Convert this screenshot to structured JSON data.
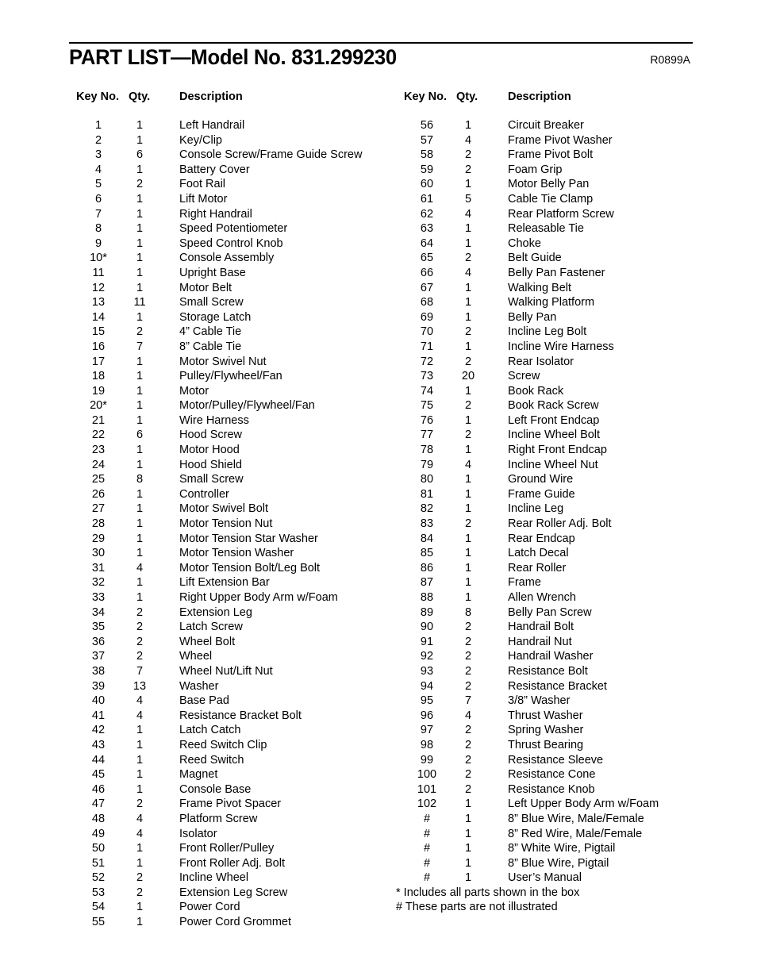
{
  "title": "PART LIST—Model No. 831.299230",
  "code": "R0899A",
  "headers": {
    "key": "Key No.",
    "qty": "Qty.",
    "desc": "Description"
  },
  "left_parts": [
    {
      "key": "1",
      "qty": "1",
      "desc": "Left Handrail"
    },
    {
      "key": "2",
      "qty": "1",
      "desc": "Key/Clip"
    },
    {
      "key": "3",
      "qty": "6",
      "desc": "Console Screw/Frame Guide Screw"
    },
    {
      "key": "4",
      "qty": "1",
      "desc": "Battery Cover"
    },
    {
      "key": "5",
      "qty": "2",
      "desc": "Foot Rail"
    },
    {
      "key": "6",
      "qty": "1",
      "desc": "Lift Motor"
    },
    {
      "key": "7",
      "qty": "1",
      "desc": "Right Handrail"
    },
    {
      "key": "8",
      "qty": "1",
      "desc": "Speed Potentiometer"
    },
    {
      "key": "9",
      "qty": "1",
      "desc": "Speed Control Knob"
    },
    {
      "key": "10*",
      "qty": "1",
      "desc": "Console Assembly"
    },
    {
      "key": "11",
      "qty": "1",
      "desc": "Upright Base"
    },
    {
      "key": "12",
      "qty": "1",
      "desc": "Motor Belt"
    },
    {
      "key": "13",
      "qty": "11",
      "desc": "Small Screw"
    },
    {
      "key": "14",
      "qty": "1",
      "desc": "Storage Latch"
    },
    {
      "key": "15",
      "qty": "2",
      "desc": "4” Cable Tie"
    },
    {
      "key": "16",
      "qty": "7",
      "desc": "8” Cable Tie"
    },
    {
      "key": "17",
      "qty": "1",
      "desc": "Motor Swivel Nut"
    },
    {
      "key": "18",
      "qty": "1",
      "desc": "Pulley/Flywheel/Fan"
    },
    {
      "key": "19",
      "qty": "1",
      "desc": "Motor"
    },
    {
      "key": "20*",
      "qty": "1",
      "desc": "Motor/Pulley/Flywheel/Fan"
    },
    {
      "key": "21",
      "qty": "1",
      "desc": "Wire Harness"
    },
    {
      "key": "22",
      "qty": "6",
      "desc": "Hood Screw"
    },
    {
      "key": "23",
      "qty": "1",
      "desc": "Motor Hood"
    },
    {
      "key": "24",
      "qty": "1",
      "desc": "Hood Shield"
    },
    {
      "key": "25",
      "qty": "8",
      "desc": "Small Screw"
    },
    {
      "key": "26",
      "qty": "1",
      "desc": "Controller"
    },
    {
      "key": "27",
      "qty": "1",
      "desc": "Motor Swivel Bolt"
    },
    {
      "key": "28",
      "qty": "1",
      "desc": "Motor Tension Nut"
    },
    {
      "key": "29",
      "qty": "1",
      "desc": "Motor Tension Star Washer"
    },
    {
      "key": "30",
      "qty": "1",
      "desc": "Motor Tension Washer"
    },
    {
      "key": "31",
      "qty": "4",
      "desc": "Motor Tension Bolt/Leg Bolt"
    },
    {
      "key": "32",
      "qty": "1",
      "desc": "Lift Extension Bar"
    },
    {
      "key": "33",
      "qty": "1",
      "desc": "Right Upper Body Arm w/Foam"
    },
    {
      "key": "34",
      "qty": "2",
      "desc": "Extension Leg"
    },
    {
      "key": "35",
      "qty": "2",
      "desc": "Latch Screw"
    },
    {
      "key": "36",
      "qty": "2",
      "desc": "Wheel Bolt"
    },
    {
      "key": "37",
      "qty": "2",
      "desc": "Wheel"
    },
    {
      "key": "38",
      "qty": "7",
      "desc": "Wheel Nut/Lift Nut"
    },
    {
      "key": "39",
      "qty": "13",
      "desc": "Washer"
    },
    {
      "key": "40",
      "qty": "4",
      "desc": "Base Pad"
    },
    {
      "key": "41",
      "qty": "4",
      "desc": "Resistance Bracket Bolt"
    },
    {
      "key": "42",
      "qty": "1",
      "desc": "Latch Catch"
    },
    {
      "key": "43",
      "qty": "1",
      "desc": "Reed Switch Clip"
    },
    {
      "key": "44",
      "qty": "1",
      "desc": "Reed Switch"
    },
    {
      "key": "45",
      "qty": "1",
      "desc": "Magnet"
    },
    {
      "key": "46",
      "qty": "1",
      "desc": "Console Base"
    },
    {
      "key": "47",
      "qty": "2",
      "desc": "Frame Pivot Spacer"
    },
    {
      "key": "48",
      "qty": "4",
      "desc": "Platform Screw"
    },
    {
      "key": "49",
      "qty": "4",
      "desc": "Isolator"
    },
    {
      "key": "50",
      "qty": "1",
      "desc": "Front Roller/Pulley"
    },
    {
      "key": "51",
      "qty": "1",
      "desc": "Front Roller Adj. Bolt"
    },
    {
      "key": "52",
      "qty": "2",
      "desc": "Incline Wheel"
    },
    {
      "key": "53",
      "qty": "2",
      "desc": "Extension Leg Screw"
    },
    {
      "key": "54",
      "qty": "1",
      "desc": "Power Cord"
    },
    {
      "key": "55",
      "qty": "1",
      "desc": "Power Cord Grommet"
    }
  ],
  "right_parts": [
    {
      "key": "56",
      "qty": "1",
      "desc": "Circuit Breaker"
    },
    {
      "key": "57",
      "qty": "4",
      "desc": "Frame Pivot Washer"
    },
    {
      "key": "58",
      "qty": "2",
      "desc": "Frame Pivot Bolt"
    },
    {
      "key": "59",
      "qty": "2",
      "desc": "Foam Grip"
    },
    {
      "key": "60",
      "qty": "1",
      "desc": "Motor Belly Pan"
    },
    {
      "key": "61",
      "qty": "5",
      "desc": "Cable Tie Clamp"
    },
    {
      "key": "62",
      "qty": "4",
      "desc": "Rear Platform Screw"
    },
    {
      "key": "63",
      "qty": "1",
      "desc": "Releasable Tie"
    },
    {
      "key": "64",
      "qty": "1",
      "desc": "Choke"
    },
    {
      "key": "65",
      "qty": "2",
      "desc": "Belt Guide"
    },
    {
      "key": "66",
      "qty": "4",
      "desc": "Belly Pan Fastener"
    },
    {
      "key": "67",
      "qty": "1",
      "desc": "Walking Belt"
    },
    {
      "key": "68",
      "qty": "1",
      "desc": "Walking Platform"
    },
    {
      "key": "69",
      "qty": "1",
      "desc": "Belly Pan"
    },
    {
      "key": "70",
      "qty": "2",
      "desc": "Incline Leg Bolt"
    },
    {
      "key": "71",
      "qty": "1",
      "desc": "Incline Wire Harness"
    },
    {
      "key": "72",
      "qty": "2",
      "desc": "Rear Isolator"
    },
    {
      "key": "73",
      "qty": "20",
      "desc": "Screw"
    },
    {
      "key": "74",
      "qty": "1",
      "desc": "Book Rack"
    },
    {
      "key": "75",
      "qty": "2",
      "desc": "Book Rack Screw"
    },
    {
      "key": "76",
      "qty": "1",
      "desc": "Left Front Endcap"
    },
    {
      "key": "77",
      "qty": "2",
      "desc": "Incline Wheel Bolt"
    },
    {
      "key": "78",
      "qty": "1",
      "desc": "Right Front Endcap"
    },
    {
      "key": "79",
      "qty": "4",
      "desc": "Incline Wheel Nut"
    },
    {
      "key": "80",
      "qty": "1",
      "desc": "Ground Wire"
    },
    {
      "key": "81",
      "qty": "1",
      "desc": "Frame Guide"
    },
    {
      "key": "82",
      "qty": "1",
      "desc": "Incline Leg"
    },
    {
      "key": "83",
      "qty": "2",
      "desc": "Rear Roller Adj. Bolt"
    },
    {
      "key": "84",
      "qty": "1",
      "desc": "Rear Endcap"
    },
    {
      "key": "85",
      "qty": "1",
      "desc": "Latch Decal"
    },
    {
      "key": "86",
      "qty": "1",
      "desc": "Rear Roller"
    },
    {
      "key": "87",
      "qty": "1",
      "desc": "Frame"
    },
    {
      "key": "88",
      "qty": "1",
      "desc": "Allen Wrench"
    },
    {
      "key": "89",
      "qty": "8",
      "desc": "Belly Pan Screw"
    },
    {
      "key": "90",
      "qty": "2",
      "desc": "Handrail Bolt"
    },
    {
      "key": "91",
      "qty": "2",
      "desc": "Handrail Nut"
    },
    {
      "key": "92",
      "qty": "2",
      "desc": "Handrail Washer"
    },
    {
      "key": "93",
      "qty": "2",
      "desc": "Resistance Bolt"
    },
    {
      "key": "94",
      "qty": "2",
      "desc": "Resistance Bracket"
    },
    {
      "key": "95",
      "qty": "7",
      "desc": "3/8” Washer"
    },
    {
      "key": "96",
      "qty": "4",
      "desc": "Thrust Washer"
    },
    {
      "key": "97",
      "qty": "2",
      "desc": "Spring Washer"
    },
    {
      "key": "98",
      "qty": "2",
      "desc": "Thrust Bearing"
    },
    {
      "key": "99",
      "qty": "2",
      "desc": "Resistance Sleeve"
    },
    {
      "key": "100",
      "qty": "2",
      "desc": "Resistance Cone"
    },
    {
      "key": "101",
      "qty": "2",
      "desc": "Resistance Knob"
    },
    {
      "key": "102",
      "qty": "1",
      "desc": "Left Upper Body Arm w/Foam"
    },
    {
      "key": "#",
      "qty": "1",
      "desc": "8” Blue Wire, Male/Female"
    },
    {
      "key": "#",
      "qty": "1",
      "desc": "8” Red Wire, Male/Female"
    },
    {
      "key": "#",
      "qty": "1",
      "desc": "8” White Wire, Pigtail"
    },
    {
      "key": "#",
      "qty": "1",
      "desc": "8” Blue Wire, Pigtail"
    },
    {
      "key": "#",
      "qty": "1",
      "desc": "User’s Manual"
    }
  ],
  "notes": [
    "* Includes all parts shown in the box",
    "# These parts are not illustrated"
  ]
}
